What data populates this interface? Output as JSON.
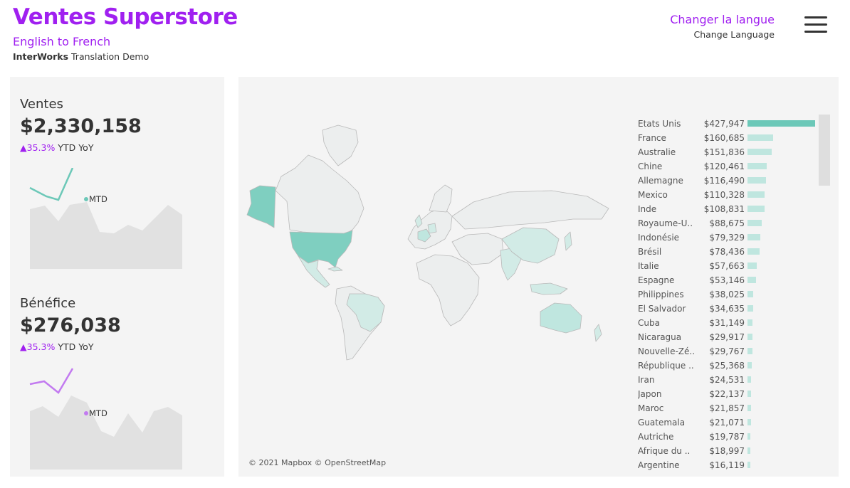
{
  "header": {
    "title": "Ventes Superstore",
    "subtitle": "English to French",
    "credit_brand": "InterWorks",
    "credit_text": "Translation Demo",
    "lang_main": "Changer la langue",
    "lang_sub": "Change Language"
  },
  "kpis": {
    "sales": {
      "label": "Ventes",
      "value": "$2,330,158",
      "delta_arrow": "▲",
      "delta_pct": "35.3%",
      "delta_text": "YTD YoY",
      "mtd_label": "MTD",
      "line_color": "#6cc8b8"
    },
    "profit": {
      "label": "Bénéfice",
      "value": "$276,038",
      "delta_arrow": "▲",
      "delta_pct": "35.3%",
      "delta_text": "YTD YoY",
      "mtd_label": "MTD",
      "line_color": "#c27af0"
    }
  },
  "map": {
    "credit": "© 2021 Mapbox  © OpenStreetMap"
  },
  "colors": {
    "accent": "#a020f0",
    "bar_top": "#6cc8b8",
    "bar_light": "#bfe6df"
  },
  "ranking": [
    {
      "name": "Etats Unis",
      "value": "$427,947",
      "amount": 427947
    },
    {
      "name": "France",
      "value": "$160,685",
      "amount": 160685
    },
    {
      "name": "Australie",
      "value": "$151,836",
      "amount": 151836
    },
    {
      "name": "Chine",
      "value": "$120,461",
      "amount": 120461
    },
    {
      "name": "Allemagne",
      "value": "$116,490",
      "amount": 116490
    },
    {
      "name": "Mexico",
      "value": "$110,328",
      "amount": 110328
    },
    {
      "name": "Inde",
      "value": "$108,831",
      "amount": 108831
    },
    {
      "name": "Royaume-U..",
      "value": "$88,675",
      "amount": 88675
    },
    {
      "name": "Indonésie",
      "value": "$79,329",
      "amount": 79329
    },
    {
      "name": "Brésil",
      "value": "$78,436",
      "amount": 78436
    },
    {
      "name": "Italie",
      "value": "$57,663",
      "amount": 57663
    },
    {
      "name": "Espagne",
      "value": "$53,146",
      "amount": 53146
    },
    {
      "name": "Philippines",
      "value": "$38,025",
      "amount": 38025
    },
    {
      "name": "El Salvador",
      "value": "$34,635",
      "amount": 34635
    },
    {
      "name": "Cuba",
      "value": "$31,149",
      "amount": 31149
    },
    {
      "name": "Nicaragua",
      "value": "$29,917",
      "amount": 29917
    },
    {
      "name": "Nouvelle-Zé..",
      "value": "$29,767",
      "amount": 29767
    },
    {
      "name": "République ..",
      "value": "$25,368",
      "amount": 25368
    },
    {
      "name": "Iran",
      "value": "$24,531",
      "amount": 24531
    },
    {
      "name": "Japon",
      "value": "$22,137",
      "amount": 22137
    },
    {
      "name": "Maroc",
      "value": "$21,857",
      "amount": 21857
    },
    {
      "name": "Guatemala",
      "value": "$21,071",
      "amount": 21071
    },
    {
      "name": "Autriche",
      "value": "$19,787",
      "amount": 19787
    },
    {
      "name": "Afrique du ..",
      "value": "$18,997",
      "amount": 18997
    },
    {
      "name": "Argentine",
      "value": "$16,119",
      "amount": 16119
    }
  ]
}
